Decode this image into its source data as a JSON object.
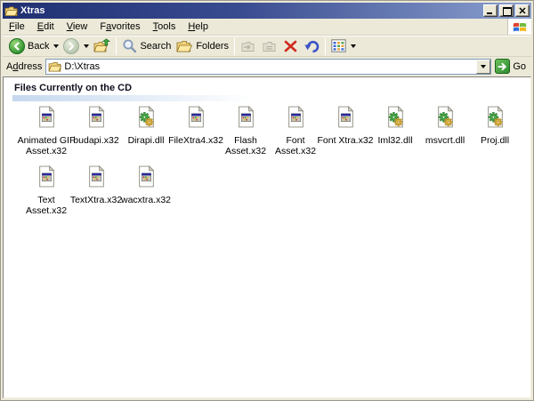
{
  "window": {
    "title": "Xtras"
  },
  "menu": {
    "items": [
      {
        "pre": "",
        "key": "F",
        "post": "ile"
      },
      {
        "pre": "",
        "key": "E",
        "post": "dit"
      },
      {
        "pre": "",
        "key": "V",
        "post": "iew"
      },
      {
        "pre": "F",
        "key": "a",
        "post": "vorites"
      },
      {
        "pre": "",
        "key": "T",
        "post": "ools"
      },
      {
        "pre": "",
        "key": "H",
        "post": "elp"
      }
    ]
  },
  "toolbar": {
    "back_label": "Back",
    "search_label": "Search",
    "folders_label": "Folders"
  },
  "addressbar": {
    "label_pre": "A",
    "label_key": "d",
    "label_post": "dress",
    "value": "D:\\Xtras",
    "go_label": "Go"
  },
  "content": {
    "group_title": "Files Currently on the CD",
    "files": [
      {
        "name": "Animated GIF\nAsset.x32",
        "type": "x32"
      },
      {
        "name": "budapi.x32",
        "type": "x32"
      },
      {
        "name": "Dirapi.dll",
        "type": "dll"
      },
      {
        "name": "FileXtra4.x32",
        "type": "x32"
      },
      {
        "name": "Flash\nAsset.x32",
        "type": "x32"
      },
      {
        "name": "Font\nAsset.x32",
        "type": "x32"
      },
      {
        "name": "Font Xtra.x32",
        "type": "x32"
      },
      {
        "name": "Iml32.dll",
        "type": "dll"
      },
      {
        "name": "msvcrt.dll",
        "type": "dll"
      },
      {
        "name": "Proj.dll",
        "type": "dll"
      },
      {
        "name": "Text\nAsset.x32",
        "type": "x32"
      },
      {
        "name": "TextXtra.x32",
        "type": "x32"
      },
      {
        "name": "wacxtra.x32",
        "type": "x32"
      }
    ]
  },
  "colors": {
    "face": "#ece9d8",
    "title_gradient_left": "#1f2f72",
    "title_gradient_right": "#8ca1d0",
    "accent_green": "#2e8b2e",
    "delete_red": "#cf2b1e",
    "undo_blue": "#3b52c8",
    "group_rule_blue": "#b2cbe9"
  }
}
